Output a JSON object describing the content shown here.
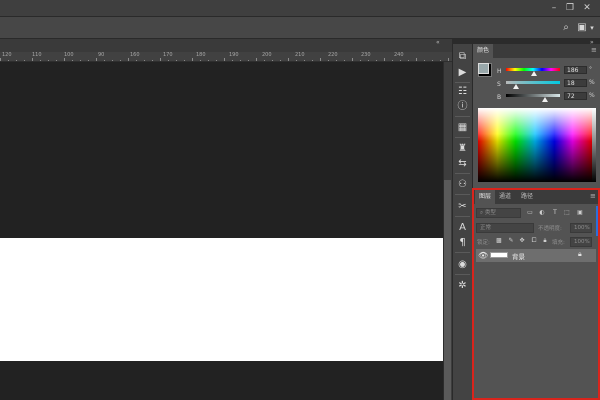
{
  "ruler": {
    "labels": [
      "120",
      "110",
      "100",
      "90",
      "160",
      "170",
      "180",
      "190",
      "200",
      "210",
      "220",
      "230",
      "240"
    ]
  },
  "color_panel": {
    "tab_label": "颜色",
    "h": {
      "label": "H",
      "value": "186",
      "unit": "°",
      "fraction": 0.52
    },
    "s": {
      "label": "S",
      "value": "18",
      "unit": "%",
      "fraction": 0.18
    },
    "b": {
      "label": "B",
      "value": "72",
      "unit": "%",
      "fraction": 0.72
    }
  },
  "layers_panel": {
    "tabs": [
      "图层",
      "通道",
      "路径"
    ],
    "search_placeholder": "类型",
    "blend_mode": "正常",
    "opacity_label": "不透明度:",
    "opacity_value": "100%",
    "lock_label": "锁定:",
    "fill_label": "填充:",
    "fill_value": "100%",
    "layer_name": "背景"
  },
  "colors": {
    "accent_highlight": "#d9241c",
    "canvas_dark": "#222222",
    "canvas_white": "#ffffff"
  },
  "icons": {
    "titlebar": [
      "minimize-icon",
      "restore-icon",
      "close-icon"
    ],
    "optbar": [
      "search-icon",
      "workspace-icon",
      "chevron-down-icon"
    ],
    "tools": [
      "history-icon",
      "play-icon",
      "properties-icon",
      "info-icon",
      "table-icon",
      "brush-preset-icon",
      "adjust-icon",
      "clone-source-icon",
      "scissors-icon",
      "character-icon",
      "paragraph-icon",
      "glyph-icon",
      "settings-icon"
    ]
  }
}
